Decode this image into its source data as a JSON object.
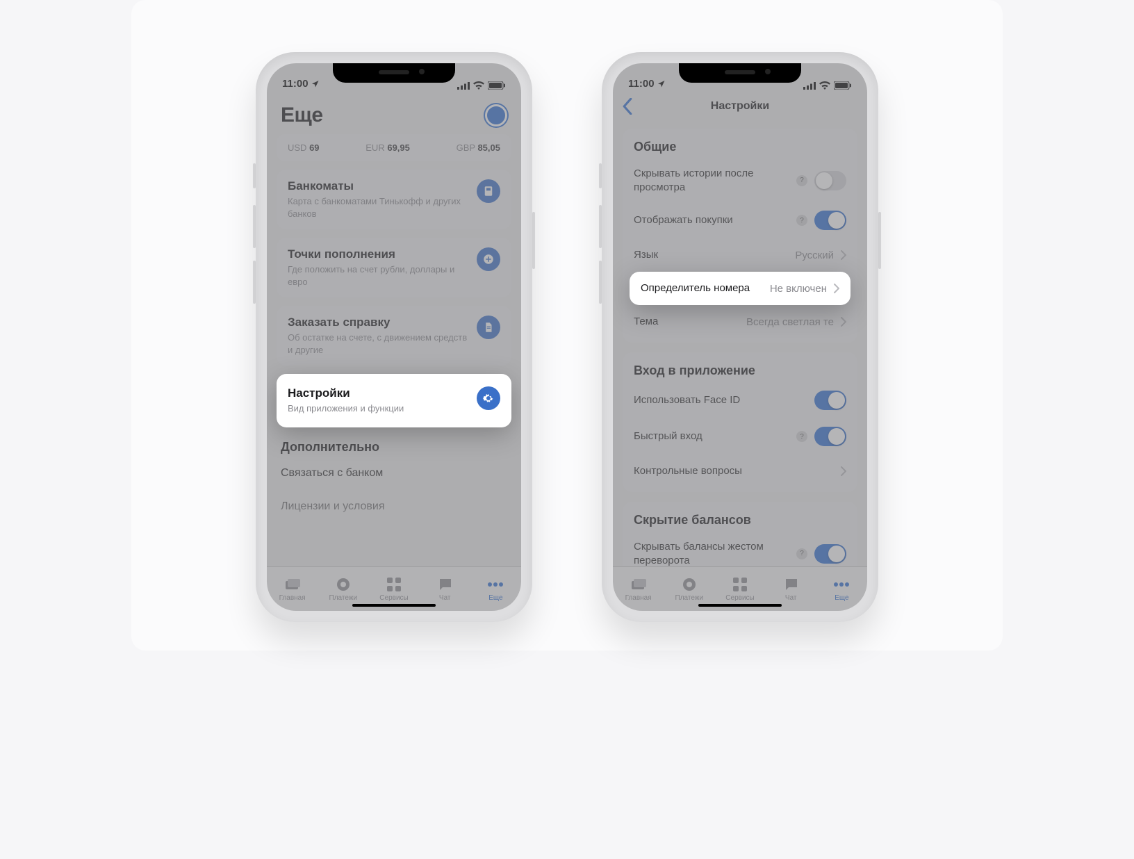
{
  "status": {
    "time": "11:00"
  },
  "tabbar": {
    "items": [
      {
        "label": "Главная"
      },
      {
        "label": "Платежи"
      },
      {
        "label": "Сервисы"
      },
      {
        "label": "Чат"
      },
      {
        "label": "Еще"
      }
    ]
  },
  "phone1": {
    "title": "Еще",
    "rates": [
      {
        "code": "USD",
        "value": "69"
      },
      {
        "code": "EUR",
        "value": "69,95"
      },
      {
        "code": "GBP",
        "value": "85,05"
      }
    ],
    "cards": [
      {
        "title": "Банкоматы",
        "subtitle": "Карта с банкоматами Тинькофф и других банков",
        "icon": "atm"
      },
      {
        "title": "Точки пополнения",
        "subtitle": "Где положить на счет рубли, доллары и евро",
        "icon": "plus"
      },
      {
        "title": "Заказать справку",
        "subtitle": "Об остатке на счете, с движением средств и другие",
        "icon": "doc"
      },
      {
        "title": "Настройки",
        "subtitle": "Вид приложения и функции",
        "icon": "gear",
        "highlight": true
      }
    ],
    "extra": {
      "header": "Дополнительно",
      "rows": [
        "Связаться с банком",
        "Лицензии и условия"
      ]
    }
  },
  "phone2": {
    "title": "Настройки",
    "group1": {
      "header": "Общие",
      "rows": [
        {
          "label": "Скрывать истории после просмотра",
          "help": true,
          "toggle": "off"
        },
        {
          "label": "Отображать покупки",
          "help": true,
          "toggle": "on"
        },
        {
          "label": "Язык",
          "value": "Русский",
          "chevron": true
        },
        {
          "label": "Определитель номера",
          "value": "Не включен",
          "chevron": true,
          "highlight": true
        },
        {
          "label": "Тема",
          "value": "Всегда светлая те",
          "chevron": true
        }
      ]
    },
    "group2": {
      "header": "Вход в приложение",
      "rows": [
        {
          "label": "Использовать Face ID",
          "toggle": "on"
        },
        {
          "label": "Быстрый вход",
          "help": true,
          "toggle": "on"
        },
        {
          "label": "Контрольные вопросы",
          "chevron": true
        }
      ]
    },
    "group3": {
      "header": "Скрытие балансов",
      "rows": [
        {
          "label": "Скрывать балансы жестом переворота",
          "help": true,
          "toggle": "on"
        }
      ]
    }
  },
  "help_char": "?"
}
